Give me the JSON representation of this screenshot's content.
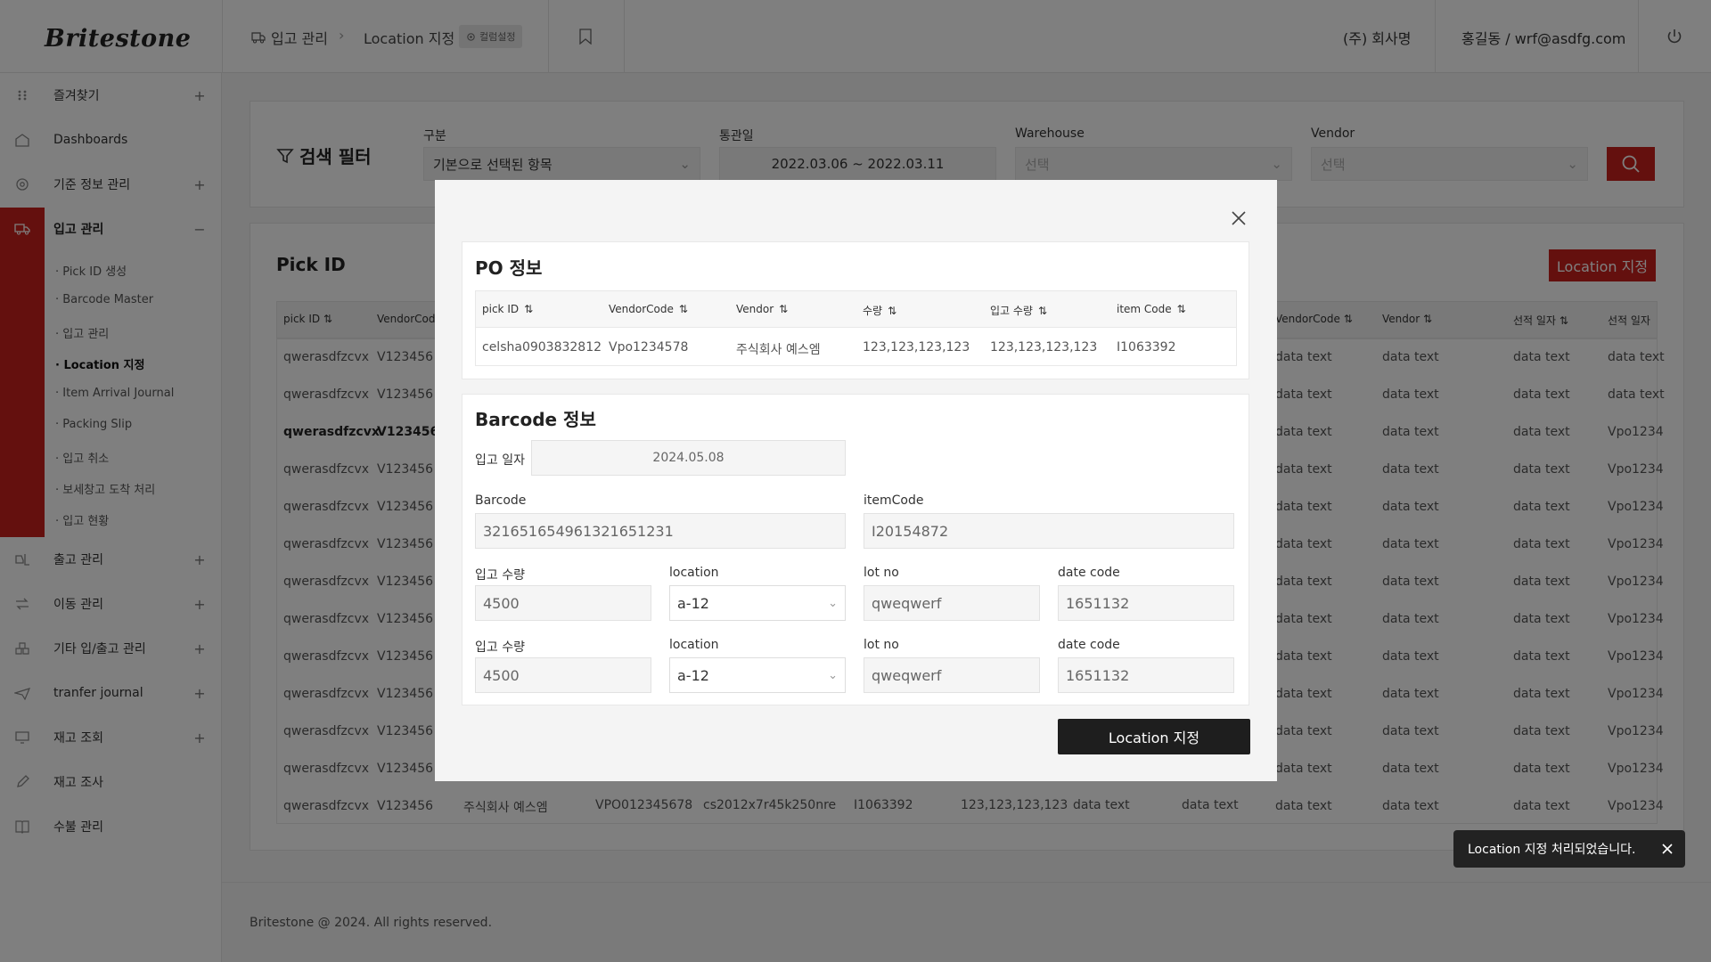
{
  "header": {
    "logo": "Britestone",
    "breadcrumb": [
      "입고 관리",
      "Location 지정"
    ],
    "column_settings": "컬럼설정",
    "company": "(주) 회사명",
    "user": "홍길동 / wrf@asdfg.com"
  },
  "sidebar": {
    "favorites": "즐겨찾기",
    "items": [
      {
        "label": "Dashboards",
        "icon": "home-icon"
      },
      {
        "label": "기준 정보 관리",
        "icon": "gear-icon"
      },
      {
        "label": "입고 관리",
        "icon": "truck-icon"
      },
      {
        "label": "출고 관리",
        "icon": "forklift-icon"
      },
      {
        "label": "이동 관리",
        "icon": "transfer-icon"
      },
      {
        "label": "기타 입/출고 관리",
        "icon": "boxes-icon"
      },
      {
        "label": "tranfer journal",
        "icon": "plane-icon"
      },
      {
        "label": "재고 조회",
        "icon": "monitor-icon"
      },
      {
        "label": "재고 조사",
        "icon": "pencil-icon"
      },
      {
        "label": "수불 관리",
        "icon": "book-icon"
      }
    ],
    "subitems": [
      "Pick ID 생성",
      "Barcode Master",
      "입고 관리",
      "Location 지정",
      "Item Arrival Journal",
      "Packing Slip",
      "입고 취소",
      "보세창고 도착 처리",
      "입고 현황"
    ]
  },
  "filter": {
    "title": "검색 필터",
    "category_label": "구분",
    "category_value": "기본으로 선택된 항목",
    "date_label": "통관일",
    "date_value": "2022.03.06 ~ 2022.03.11",
    "warehouse_label": "Warehouse",
    "warehouse_placeholder": "선택",
    "vendor_label": "Vendor",
    "vendor_placeholder": "선택"
  },
  "list": {
    "title": "Pick ID",
    "action_button": "Location 지정",
    "left_headers": [
      "pick ID",
      "VendorCode"
    ],
    "right_headers": [
      "VendorCode",
      "Vendor",
      "선적 일자",
      "선적 일자"
    ],
    "rows_left": [
      [
        "qwerasdfzcvx",
        "V123456"
      ],
      [
        "qwerasdfzcvx",
        "V123456"
      ],
      [
        "qwerasdfzcvx",
        "V123456"
      ],
      [
        "qwerasdfzcvx",
        "V123456"
      ],
      [
        "qwerasdfzcvx",
        "V123456"
      ],
      [
        "qwerasdfzcvx",
        "V123456"
      ],
      [
        "qwerasdfzcvx",
        "V123456"
      ],
      [
        "qwerasdfzcvx",
        "V123456"
      ],
      [
        "qwerasdfzcvx",
        "V123456"
      ],
      [
        "qwerasdfzcvx",
        "V123456"
      ],
      [
        "qwerasdfzcvx",
        "V123456"
      ],
      [
        "qwerasdfzcvx",
        "V123456"
      ],
      [
        "qwerasdfzcvx",
        "V123456"
      ]
    ],
    "rows_right": [
      [
        "data text",
        "data text",
        "data text",
        "data text"
      ],
      [
        "data text",
        "data text",
        "data text",
        "data text"
      ],
      [
        "data text",
        "data text",
        "data text",
        "Vpo1234"
      ],
      [
        "data text",
        "data text",
        "data text",
        "Vpo1234"
      ],
      [
        "data text",
        "data text",
        "data text",
        "Vpo1234"
      ],
      [
        "data text",
        "data text",
        "data text",
        "Vpo1234"
      ],
      [
        "data text",
        "data text",
        "data text",
        "Vpo1234"
      ],
      [
        "data text",
        "data text",
        "data text",
        "Vpo1234"
      ],
      [
        "data text",
        "data text",
        "data text",
        "Vpo1234"
      ],
      [
        "data text",
        "data text",
        "data text",
        "Vpo1234"
      ],
      [
        "data text",
        "data text",
        "data text",
        "Vpo1234"
      ],
      [
        "data text",
        "data text",
        "data text",
        "Vpo1234"
      ],
      [
        "data text",
        "data text",
        "data text",
        "Vpo1234"
      ]
    ],
    "last_row_mid": [
      "주식회사 예스엠",
      "VPO012345678",
      "cs2012x7r45k250nre",
      "I1063392",
      "123,123,123,123",
      "data text",
      "data text"
    ]
  },
  "modal": {
    "po_title": "PO 정보",
    "po_headers": [
      "pick ID",
      "VendorCode",
      "Vendor",
      "수량",
      "입고 수량",
      "item Code"
    ],
    "po_row": [
      "celsha0903832812",
      "Vpo1234578",
      "주식회사 예스엠",
      "123,123,123,123",
      "123,123,123,123",
      "I1063392"
    ],
    "barcode_title": "Barcode 정보",
    "date_label": "입고 일자",
    "date_value": "2024.05.08",
    "barcode_label": "Barcode",
    "barcode_value": "321651654961321651231",
    "itemcode_label": "itemCode",
    "itemcode_value": "I20154872",
    "rows": [
      {
        "qty_label": "입고 수량",
        "qty": "4500",
        "loc_label": "location",
        "loc": "a-12",
        "lot_label": "lot no",
        "lot": "qweqwerf",
        "dc_label": "date code",
        "dc": "1651132"
      },
      {
        "qty_label": "입고 수량",
        "qty": "4500",
        "loc_label": "location",
        "loc": "a-12",
        "lot_label": "lot no",
        "lot": "qweqwerf",
        "dc_label": "date code",
        "dc": "1651132"
      }
    ],
    "action": "Location 지정"
  },
  "toast": {
    "message": "Location 지정 처리되었습니다."
  },
  "footer": "Britestone @ 2024. All rights reserved.",
  "colors": {
    "accent": "#c8201c",
    "dark_button": "#1e1e1e"
  }
}
